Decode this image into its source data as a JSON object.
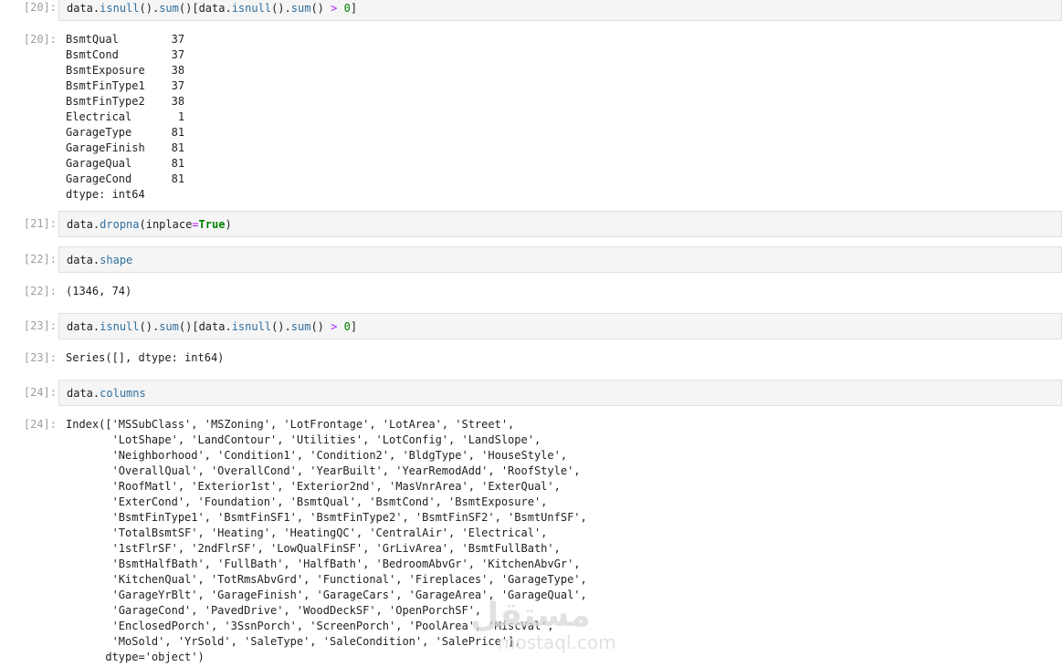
{
  "cells": [
    {
      "in_prompt": "[20]:",
      "code": [
        {
          "t": "data",
          "c": "v"
        },
        {
          "t": ".",
          "c": "v"
        },
        {
          "t": "isnull",
          "c": "f"
        },
        {
          "t": "().",
          "c": "v"
        },
        {
          "t": "sum",
          "c": "f"
        },
        {
          "t": "()[",
          "c": "v"
        },
        {
          "t": "data",
          "c": "v"
        },
        {
          "t": ".",
          "c": "v"
        },
        {
          "t": "isnull",
          "c": "f"
        },
        {
          "t": "().",
          "c": "v"
        },
        {
          "t": "sum",
          "c": "f"
        },
        {
          "t": "() ",
          "c": "v"
        },
        {
          "t": ">",
          "c": "o"
        },
        {
          "t": " ",
          "c": "v"
        },
        {
          "t": "0",
          "c": "n"
        },
        {
          "t": "]",
          "c": "v"
        }
      ],
      "out_prompt": "[20]:",
      "output": "BsmtQual        37\nBsmtCond        37\nBsmtExposure    38\nBsmtFinType1    37\nBsmtFinType2    38\nElectrical       1\nGarageType      81\nGarageFinish    81\nGarageQual      81\nGarageCond      81\ndtype: int64"
    },
    {
      "in_prompt": "[21]:",
      "code": [
        {
          "t": "data",
          "c": "v"
        },
        {
          "t": ".",
          "c": "v"
        },
        {
          "t": "dropna",
          "c": "f"
        },
        {
          "t": "(inplace",
          "c": "v"
        },
        {
          "t": "=",
          "c": "o"
        },
        {
          "t": "True",
          "c": "k"
        },
        {
          "t": ")",
          "c": "v"
        }
      ]
    },
    {
      "in_prompt": "[22]:",
      "code": [
        {
          "t": "data",
          "c": "v"
        },
        {
          "t": ".",
          "c": "v"
        },
        {
          "t": "shape",
          "c": "f"
        }
      ],
      "out_prompt": "[22]:",
      "output": "(1346, 74)"
    },
    {
      "in_prompt": "[23]:",
      "code": [
        {
          "t": "data",
          "c": "v"
        },
        {
          "t": ".",
          "c": "v"
        },
        {
          "t": "isnull",
          "c": "f"
        },
        {
          "t": "().",
          "c": "v"
        },
        {
          "t": "sum",
          "c": "f"
        },
        {
          "t": "()[",
          "c": "v"
        },
        {
          "t": "data",
          "c": "v"
        },
        {
          "t": ".",
          "c": "v"
        },
        {
          "t": "isnull",
          "c": "f"
        },
        {
          "t": "().",
          "c": "v"
        },
        {
          "t": "sum",
          "c": "f"
        },
        {
          "t": "() ",
          "c": "v"
        },
        {
          "t": ">",
          "c": "o"
        },
        {
          "t": " ",
          "c": "v"
        },
        {
          "t": "0",
          "c": "n"
        },
        {
          "t": "]",
          "c": "v"
        }
      ],
      "out_prompt": "[23]:",
      "output": "Series([], dtype: int64)"
    },
    {
      "in_prompt": "[24]:",
      "code": [
        {
          "t": "data",
          "c": "v"
        },
        {
          "t": ".",
          "c": "v"
        },
        {
          "t": "columns",
          "c": "f"
        }
      ],
      "out_prompt": "[24]:",
      "output": "Index(['MSSubClass', 'MSZoning', 'LotFrontage', 'LotArea', 'Street',\n       'LotShape', 'LandContour', 'Utilities', 'LotConfig', 'LandSlope',\n       'Neighborhood', 'Condition1', 'Condition2', 'BldgType', 'HouseStyle',\n       'OverallQual', 'OverallCond', 'YearBuilt', 'YearRemodAdd', 'RoofStyle',\n       'RoofMatl', 'Exterior1st', 'Exterior2nd', 'MasVnrArea', 'ExterQual',\n       'ExterCond', 'Foundation', 'BsmtQual', 'BsmtCond', 'BsmtExposure',\n       'BsmtFinType1', 'BsmtFinSF1', 'BsmtFinType2', 'BsmtFinSF2', 'BsmtUnfSF',\n       'TotalBsmtSF', 'Heating', 'HeatingQC', 'CentralAir', 'Electrical',\n       '1stFlrSF', '2ndFlrSF', 'LowQualFinSF', 'GrLivArea', 'BsmtFullBath',\n       'BsmtHalfBath', 'FullBath', 'HalfBath', 'BedroomAbvGr', 'KitchenAbvGr',\n       'KitchenQual', 'TotRmsAbvGrd', 'Functional', 'Fireplaces', 'GarageType',\n       'GarageYrBlt', 'GarageFinish', 'GarageCars', 'GarageArea', 'GarageQual',\n       'GarageCond', 'PavedDrive', 'WoodDeckSF', 'OpenPorchSF',\n       'EnclosedPorch', '3SsnPorch', 'ScreenPorch', 'PoolArea', 'MiscVal',\n       'MoSold', 'YrSold', 'SaleType', 'SaleCondition', 'SalePrice'],\n      dtype='object')"
    }
  ],
  "watermark": {
    "arabic": "مستقل",
    "url": "mostaql.com"
  }
}
